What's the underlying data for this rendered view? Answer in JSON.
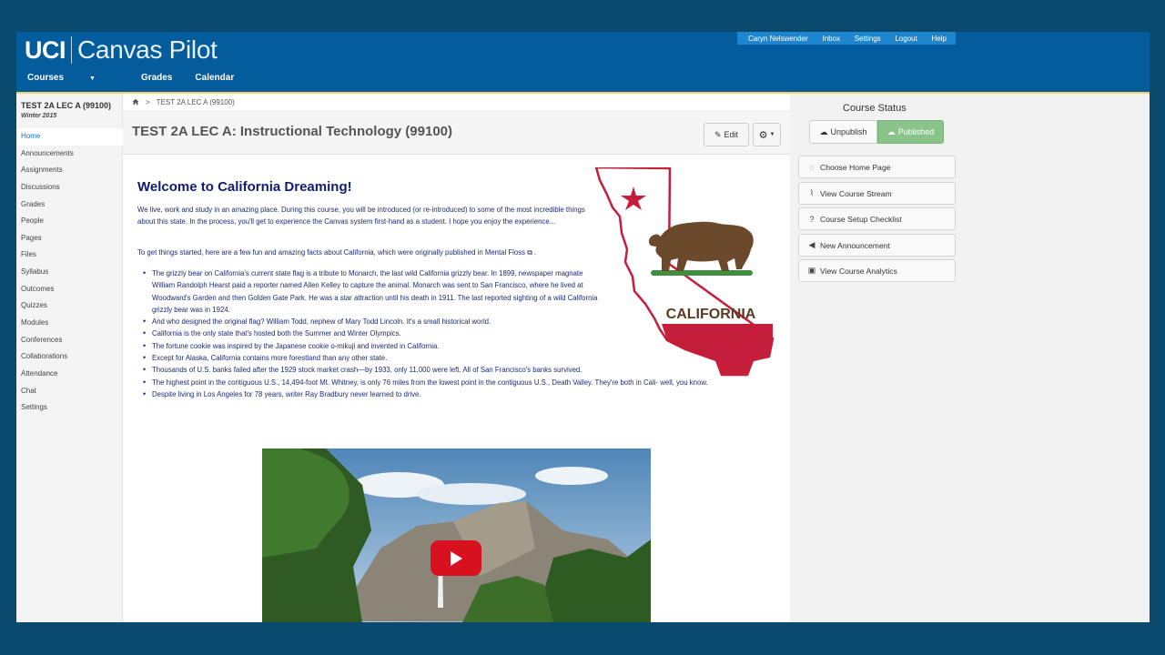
{
  "app": {
    "logo_primary": "UCI",
    "logo_secondary": "Canvas Pilot"
  },
  "user_nav": [
    "Caryn Nelswender",
    "Inbox",
    "Settings",
    "Logout",
    "Help"
  ],
  "main_nav": {
    "courses": "Courses",
    "grades": "Grades",
    "calendar": "Calendar"
  },
  "course": {
    "title": "TEST 2A LEC A (99100)",
    "term": "Winter 2015"
  },
  "sidebar": {
    "items": [
      {
        "label": "Home",
        "active": true
      },
      {
        "label": "Announcements"
      },
      {
        "label": "Assignments"
      },
      {
        "label": "Discussions"
      },
      {
        "label": "Grades"
      },
      {
        "label": "People"
      },
      {
        "label": "Pages"
      },
      {
        "label": "Files"
      },
      {
        "label": "Syllabus"
      },
      {
        "label": "Outcomes"
      },
      {
        "label": "Quizzes"
      },
      {
        "label": "Modules"
      },
      {
        "label": "Conferences"
      },
      {
        "label": "Collaborations"
      },
      {
        "label": "Attendance"
      },
      {
        "label": "Chat"
      },
      {
        "label": "Settings"
      }
    ]
  },
  "breadcrumb": {
    "course": "TEST 2A LEC A (99100)"
  },
  "page": {
    "title": "TEST 2A LEC A: Instructional Technology (99100)",
    "edit_label": "Edit"
  },
  "body": {
    "heading": "Welcome to California Dreaming!",
    "intro": "We live, work and study in an amazing place. During this course, you will be introduced (or re-introduced) to some of the most incredible things about this state. In the process, you'll get to experience the Canvas system first-hand as a student. I hope you enjoy the experience...",
    "to_start": "To get things started, here are a few fun and amazing facts about California, which were originally published in",
    "source_link": "Mental Floss",
    "facts": [
      "The grizzly bear on California's current state flag is a tribute to Monarch, the last wild California grizzly bear. In 1899, newspaper magnate William Randolph Hearst paid a reporter named Allen Kelley to capture the animal. Monarch was sent to San Francisco, where he lived at Woodward's Garden and then Golden Gate Park. He was a star attraction until his death in 1911. The last reported sighting of a wild California grizzly bear was in 1924.",
      "And who designed the original flag? William Todd, nephew of Mary Todd Lincoln. It's a small historical world.",
      "California is the only state that's hosted both the Summer and Winter Olympics.",
      "The fortune cookie was inspired by the Japanese cookie o-mikuji and invented in California.",
      "Except for Alaska, California contains more forestland than any other state.",
      "Thousands of U.S. banks failed after the 1929 stock market crash—by 1933, only 11,000 were left. All of San Francisco's banks survived.",
      "The highest point in the contiguous U.S., 14,494-foot Mt. Whitney, is only 76 miles from the lowest point in the contiguous U.S., Death Valley. They're both in Cali- well, you know.",
      "Despite living in Los Angeles for 78 years, writer Ray Bradbury never learned to drive."
    ],
    "map_label": "CALIFORNIA"
  },
  "right": {
    "status_label": "Course Status",
    "unpublish": "Unpublish",
    "published": "Published",
    "actions": [
      {
        "label": "Choose Home Page",
        "icon": "home-page-icon"
      },
      {
        "label": "View Course Stream",
        "icon": "stream-icon"
      },
      {
        "label": "Course Setup Checklist",
        "icon": "checklist-icon"
      },
      {
        "label": "New Announcement",
        "icon": "megaphone-icon"
      },
      {
        "label": "View Course Analytics",
        "icon": "analytics-icon"
      }
    ]
  },
  "colors": {
    "brand_blue": "#035d9c",
    "gold": "#f3d36b",
    "published_green": "#8bc48b",
    "ca_red": "#c41e3a",
    "bear_brown": "#6b4a2b"
  }
}
